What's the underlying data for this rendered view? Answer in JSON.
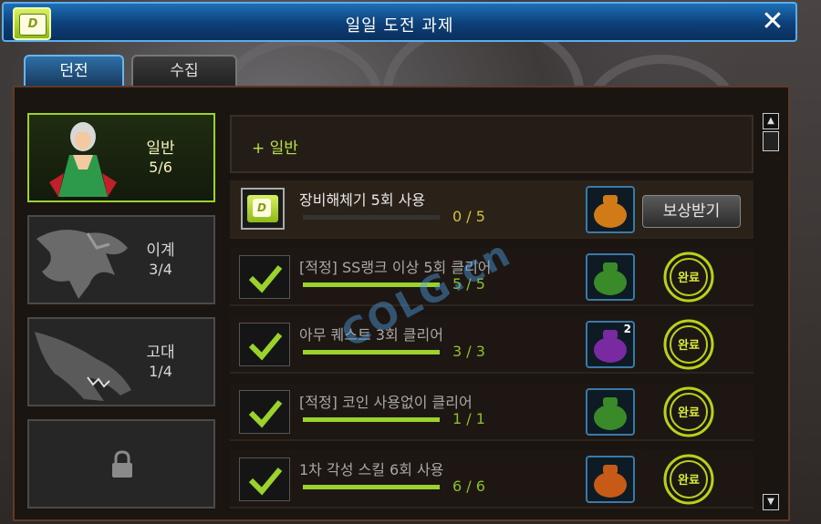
{
  "window": {
    "title": "일일 도전 과제",
    "close_icon": "close-icon",
    "logo_icon": "scroll-logo-icon"
  },
  "tabs": [
    {
      "label": "던전",
      "active": true
    },
    {
      "label": "수집",
      "active": false
    }
  ],
  "categories": [
    {
      "name": "일반",
      "count": "5/6",
      "selected": true
    },
    {
      "name": "이계",
      "count": "3/4",
      "selected": false
    },
    {
      "name": "고대",
      "count": "1/4",
      "selected": false
    },
    {
      "name": "",
      "count": "",
      "locked": true,
      "icon": "lock-icon"
    }
  ],
  "list_header": "+ 일반",
  "tasks": [
    {
      "title": "장비해체기 5회 사용",
      "progress": "0 / 5",
      "completed": false,
      "fraction": 0.0,
      "reward_color": "#d07a18",
      "claim_label": "보상받기"
    },
    {
      "title": "[적정] SS랭크 이상 5회 클리어",
      "progress": "5 / 5",
      "completed": true,
      "fraction": 1.0,
      "reward_color": "#3a8a2a",
      "stamp_label": "완료"
    },
    {
      "title": "아무 퀘스트 3회 클리어",
      "progress": "3 / 3",
      "completed": true,
      "fraction": 1.0,
      "reward_color": "#7a2aa0",
      "reward_badge": "2",
      "stamp_label": "완료"
    },
    {
      "title": "[적정] 코인 사용없이 클리어",
      "progress": "1 / 1",
      "completed": true,
      "fraction": 1.0,
      "reward_color": "#3a8a2a",
      "stamp_label": "완료"
    },
    {
      "title": "1차 각성 스킬 6회 사용",
      "progress": "6 / 6",
      "completed": true,
      "fraction": 1.0,
      "reward_color": "#c85a18",
      "stamp_label": "완료"
    }
  ],
  "watermark": "COLG.cn",
  "colors": {
    "accent": "#9bd22c",
    "title_bar": "#1d6fb6"
  }
}
